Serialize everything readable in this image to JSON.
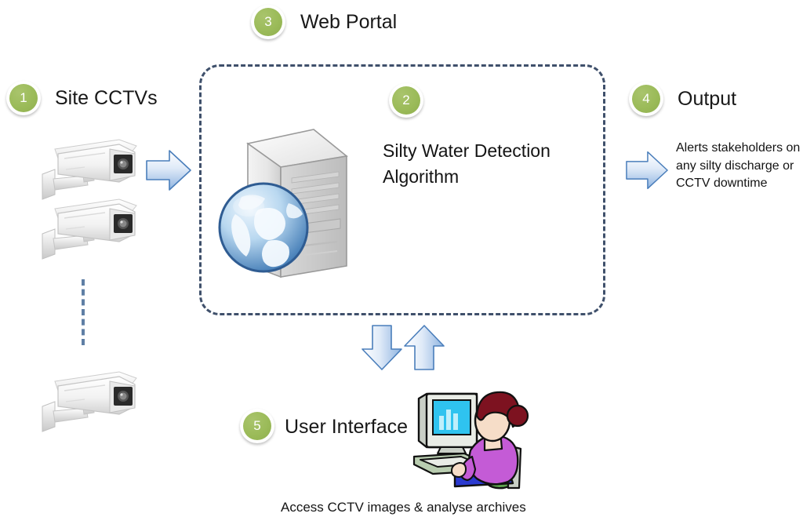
{
  "diagram": {
    "title_step": "Web Portal",
    "background": "#ffffff",
    "accent_green": "#9BBB59",
    "dashed_border_color": "#3F506B",
    "arrow_blue": "#7FA8DC"
  },
  "steps": {
    "one": {
      "number": "1",
      "label": "Site CCTVs"
    },
    "two": {
      "number": "2",
      "label": "Silty Water  Detection\nAlgorithm"
    },
    "three": {
      "number": "3",
      "label": "Web Portal"
    },
    "four": {
      "number": "4",
      "label": "Output"
    },
    "five": {
      "number": "5",
      "label": "User Interface"
    }
  },
  "output": {
    "body": "Alerts stakeholders on any silty discharge or CCTV downtime"
  },
  "footer": {
    "caption": "Access  CCTV images & analyse archives"
  },
  "icons": {
    "camera_1": "cctv-camera-icon",
    "camera_2": "cctv-camera-icon",
    "camera_3": "cctv-camera-icon",
    "server": "web-server-globe-icon",
    "person": "person-at-computer-icon",
    "arrow_right_in": "arrow-right-icon",
    "arrow_right_out": "arrow-right-icon",
    "arrow_down": "arrow-down-icon",
    "arrow_up": "arrow-up-icon",
    "vertical_ellipsis": "dashed-continuation-line"
  }
}
